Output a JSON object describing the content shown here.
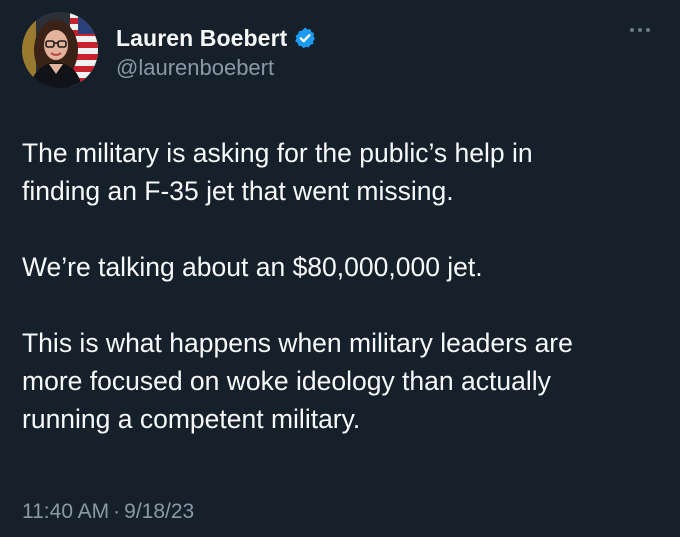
{
  "author": {
    "display_name": "Lauren Boebert",
    "handle": "@laurenboebert",
    "verified": true,
    "verified_color": "#1d9bf0"
  },
  "tweet": {
    "paragraphs": [
      {
        "lines": [
          "The military is asking for the public’s help in",
          "finding an F-35 jet that went missing."
        ]
      },
      {
        "lines": [
          "We’re talking about an $80,000,000 jet."
        ]
      },
      {
        "lines": [
          "This is what happens when military leaders are",
          "more focused on woke ideology than actually",
          "running a competent military."
        ]
      }
    ],
    "time": "11:40 AM",
    "separator": "·",
    "date": "9/18/23"
  },
  "icons": {
    "verified": "verified-badge-icon",
    "more": "more-options-icon"
  },
  "theme": {
    "background": "#15202b",
    "text": "#f7f9f9",
    "secondary_text": "#8b98a5"
  }
}
